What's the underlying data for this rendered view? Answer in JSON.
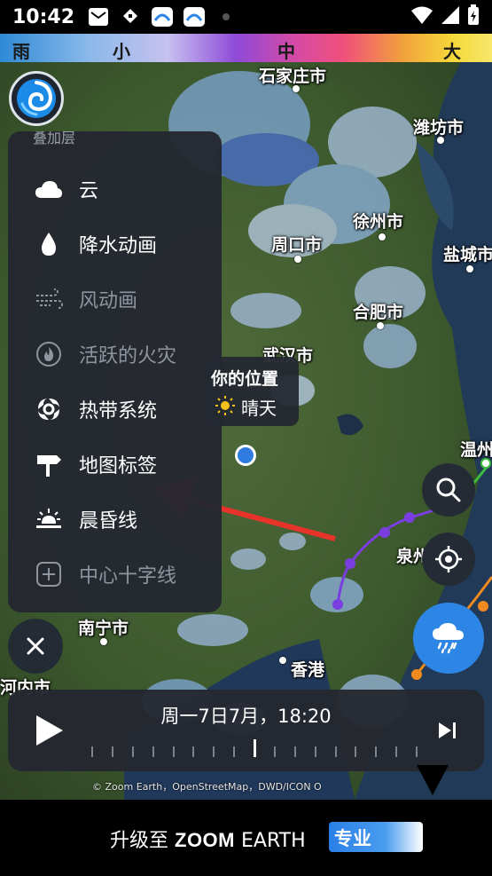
{
  "status_bar": {
    "time": "10:42"
  },
  "legend": {
    "labels": [
      "雨",
      "小",
      "中",
      "大"
    ]
  },
  "map": {
    "cities": [
      "石家庄市",
      "潍坊市",
      "徐州市",
      "周口市",
      "盐城市",
      "合肥市",
      "武汉市",
      "温州",
      "泉州",
      "南宁市",
      "香港",
      "河内市"
    ]
  },
  "layers_menu": {
    "header": "叠加层",
    "items": [
      {
        "label": "云",
        "icon": "cloud-icon",
        "enabled": true
      },
      {
        "label": "降水动画",
        "icon": "raindrop-icon",
        "enabled": true
      },
      {
        "label": "风动画",
        "icon": "wind-icon",
        "enabled": false
      },
      {
        "label": "活跃的火灾",
        "icon": "fire-icon",
        "enabled": false
      },
      {
        "label": "热带系统",
        "icon": "hurricane-icon",
        "enabled": true
      },
      {
        "label": "地图标签",
        "icon": "signpost-icon",
        "enabled": true
      },
      {
        "label": "晨昏线",
        "icon": "sunrise-icon",
        "enabled": true
      },
      {
        "label": "中心十字线",
        "icon": "plus-box-icon",
        "enabled": false
      }
    ]
  },
  "location_tooltip": {
    "title": "你的位置",
    "weather": "晴天"
  },
  "timeline": {
    "datetime": "周一7日7月，18:20"
  },
  "attribution": "© Zoom Earth，OpenStreetMap，DWD/ICON O",
  "banner": {
    "prefix": "升级至 ",
    "brand_bold": "ZOOM",
    "brand_rest": " EARTH",
    "badge": "专业"
  },
  "colors": {
    "accent_blue": "#2d86e6",
    "panel_bg": "#242830",
    "annotation_arrow": "#e8332b",
    "storm_track": "#7a3ee0"
  }
}
